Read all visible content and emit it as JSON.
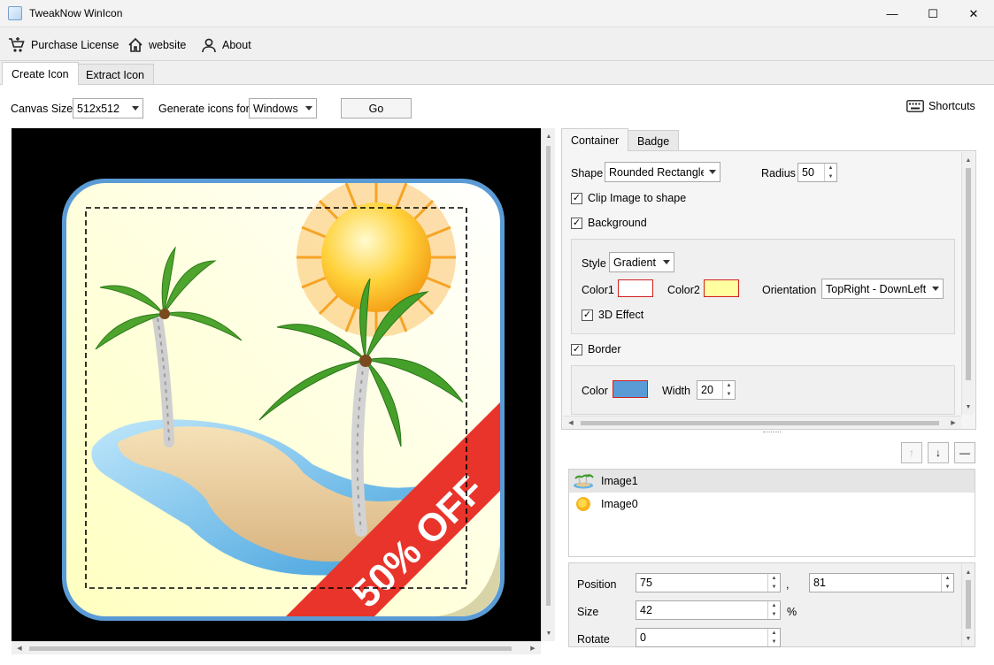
{
  "window": {
    "title": "TweakNow WinIcon",
    "controls": {
      "minimize": "—",
      "maximize": "☐",
      "close": "✕"
    }
  },
  "toolbar": {
    "purchase_label": "Purchase License",
    "website_label": "website",
    "about_label": "About"
  },
  "tabs": [
    {
      "label": "Create Icon",
      "active": true
    },
    {
      "label": "Extract Icon",
      "active": false
    }
  ],
  "options": {
    "canvas_size_label": "Canvas Size:",
    "canvas_size_value": "512x512",
    "generate_label": "Generate icons for",
    "generate_value": "Windows",
    "go_label": "Go",
    "shortcuts_label": "Shortcuts"
  },
  "preview": {
    "badge_text": "50% OFF",
    "badge_color": "#e8342a",
    "border_color": "#5b9bd5",
    "background_gradient": [
      "#ffffff",
      "#ffffc0"
    ]
  },
  "panel_tabs": [
    {
      "label": "Container",
      "active": true
    },
    {
      "label": "Badge",
      "active": false
    }
  ],
  "container": {
    "shape_label": "Shape",
    "shape_value": "Rounded Rectangle",
    "radius_label": "Radius",
    "radius_value": "50",
    "clip_label": "Clip Image to shape",
    "clip_checked": true,
    "background_label": "Background",
    "background_checked": true,
    "style_label": "Style",
    "style_value": "Gradient",
    "color1_label": "Color1",
    "color1_value": "#ffffff",
    "color2_label": "Color2",
    "color2_value": "#ffffa0",
    "orientation_label": "Orientation",
    "orientation_value": "TopRight - DownLeft",
    "effect3d_label": "3D Effect",
    "effect3d_checked": true,
    "border_label": "Border",
    "border_checked": true,
    "border_color_label": "Color",
    "border_color_value": "#5b9bd5",
    "width_label": "Width",
    "width_value": "20"
  },
  "layers": [
    {
      "name": "Image1",
      "icon": "palm-island-icon",
      "selected": true
    },
    {
      "name": "Image0",
      "icon": "sun-icon",
      "selected": false
    }
  ],
  "layer_props": {
    "position_label": "Position",
    "position_x": "75",
    "position_sep": ",",
    "position_y": "81",
    "size_label": "Size",
    "size_value": "42",
    "size_unit": "%",
    "rotate_label": "Rotate",
    "rotate_value": "0"
  }
}
